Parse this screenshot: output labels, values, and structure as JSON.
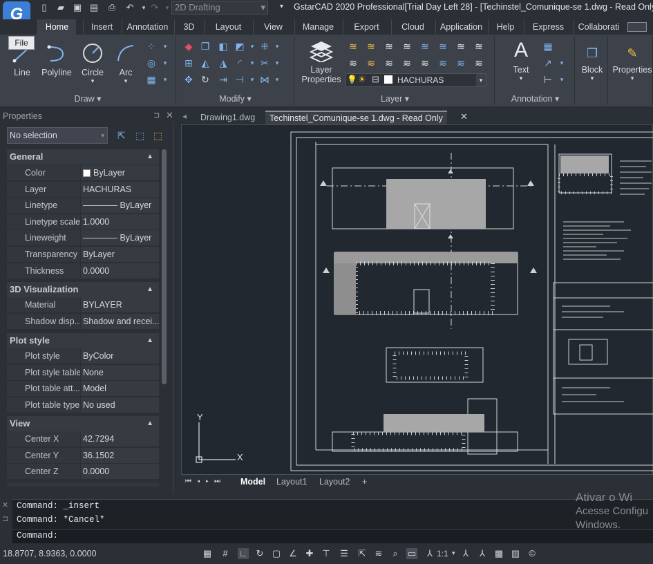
{
  "app": {
    "title": "GstarCAD 2020 Professional[Trial Day Left 28] - [Techinstel_Comunique-se 1.dwg - Read Only]",
    "workspace": "2D Drafting",
    "file_label": "File"
  },
  "menu_tabs": [
    "Home",
    "Insert",
    "Annotation",
    "3D",
    "Layout",
    "View",
    "Manage",
    "Export",
    "Cloud",
    "Application",
    "Help",
    "Express",
    "Collaborati"
  ],
  "ribbon": {
    "draw": {
      "label": "Draw ▾",
      "line": "Line",
      "polyline": "Polyline",
      "circle": "Circle",
      "arc": "Arc"
    },
    "modify": {
      "label": "Modify ▾"
    },
    "layer": {
      "label": "Layer ▾",
      "layer_properties": "Layer Properties",
      "current_layer": "HACHURAS"
    },
    "annotation": {
      "label": "Annotation ▾",
      "text": "Text"
    },
    "block": {
      "label": "Block"
    },
    "properties": {
      "label": "Properties"
    }
  },
  "properties_panel": {
    "title": "Properties",
    "selection": "No selection",
    "sections": {
      "general": "General",
      "viz3d": "3D Visualization",
      "plot": "Plot style",
      "view": "View"
    },
    "general": [
      {
        "k": "Color",
        "v": "ByLayer"
      },
      {
        "k": "Layer",
        "v": "HACHURAS"
      },
      {
        "k": "Linetype",
        "v": "———— ByLayer"
      },
      {
        "k": "Linetype scale",
        "v": "1.0000"
      },
      {
        "k": "Lineweight",
        "v": "———— ByLayer"
      },
      {
        "k": "Transparency",
        "v": "ByLayer"
      },
      {
        "k": "Thickness",
        "v": "0.0000"
      }
    ],
    "viz3d": [
      {
        "k": "Material",
        "v": "BYLAYER"
      },
      {
        "k": "Shadow disp...",
        "v": "Shadow and recei..."
      }
    ],
    "plot": [
      {
        "k": "Plot style",
        "v": "ByColor"
      },
      {
        "k": "Plot style table",
        "v": "None"
      },
      {
        "k": "Plot table att...",
        "v": "Model"
      },
      {
        "k": "Plot table type",
        "v": "No used"
      }
    ],
    "view": [
      {
        "k": "Center X",
        "v": "42.7294"
      },
      {
        "k": "Center Y",
        "v": "36.1502"
      },
      {
        "k": "Center Z",
        "v": "0.0000"
      }
    ]
  },
  "doc_tabs": [
    "Drawing1.dwg",
    "Techinstel_Comunique-se 1.dwg - Read Only"
  ],
  "layout_tabs": [
    "Model",
    "Layout1",
    "Layout2",
    "+"
  ],
  "ucs": {
    "x": "X",
    "y": "Y"
  },
  "command": {
    "lines": [
      "Command: _insert",
      "Command: *Cancel*"
    ],
    "prompt": "Command:"
  },
  "status": {
    "coords": "18.8707, 8.9363, 0.0000",
    "scale": "1:1"
  },
  "watermark": [
    "Ativar o Wi",
    "Acesse Configu",
    "Windows."
  ]
}
